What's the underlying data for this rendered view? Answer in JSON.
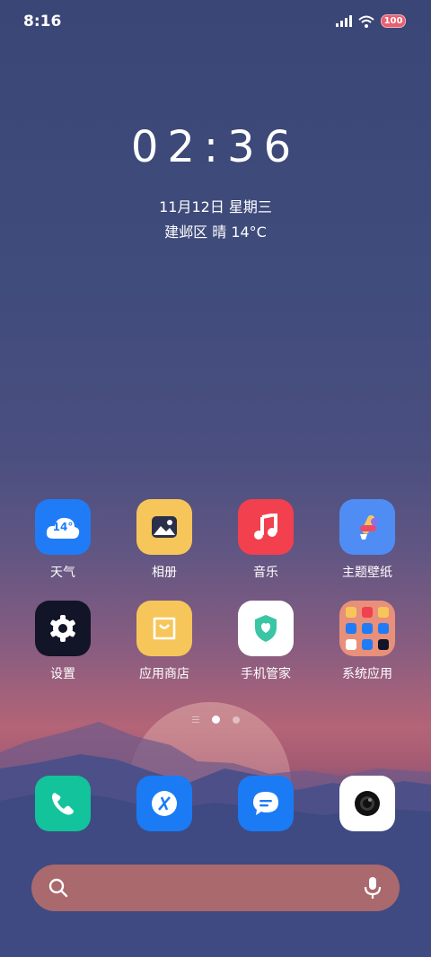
{
  "status_bar": {
    "time": "8:16",
    "battery": "100"
  },
  "lockclock": {
    "time": "02:36",
    "date": "11月12日 星期三",
    "weather": "建邺区 晴 14°C"
  },
  "weather_icon_text": "14°",
  "apps": [
    {
      "label": "天气",
      "icon": "weather-icon",
      "color": "#1f7cf6"
    },
    {
      "label": "相册",
      "icon": "photos-icon",
      "color": "#f7c65a"
    },
    {
      "label": "音乐",
      "icon": "music-icon",
      "color": "#f2404e"
    },
    {
      "label": "主题壁纸",
      "icon": "themes-icon",
      "color": "#4f8df5"
    },
    {
      "label": "设置",
      "icon": "settings-icon",
      "color": "#121427"
    },
    {
      "label": "应用商店",
      "icon": "app-store-icon",
      "color": "#f7c65a"
    },
    {
      "label": "手机管家",
      "icon": "phone-manager-icon",
      "color": "#ffffff"
    },
    {
      "label": "系统应用",
      "icon": "system-apps-folder-icon",
      "color": "#e8907a"
    }
  ],
  "dock": [
    {
      "name": "phone",
      "icon": "phone-icon",
      "color": "#13c39b"
    },
    {
      "name": "browser",
      "icon": "browser-icon",
      "color": "#1a7bf5"
    },
    {
      "name": "messages",
      "icon": "messages-icon",
      "color": "#1a7bf5"
    },
    {
      "name": "camera",
      "icon": "camera-icon",
      "color": "#ffffff"
    }
  ],
  "pages": {
    "current": 2,
    "total": 2
  }
}
